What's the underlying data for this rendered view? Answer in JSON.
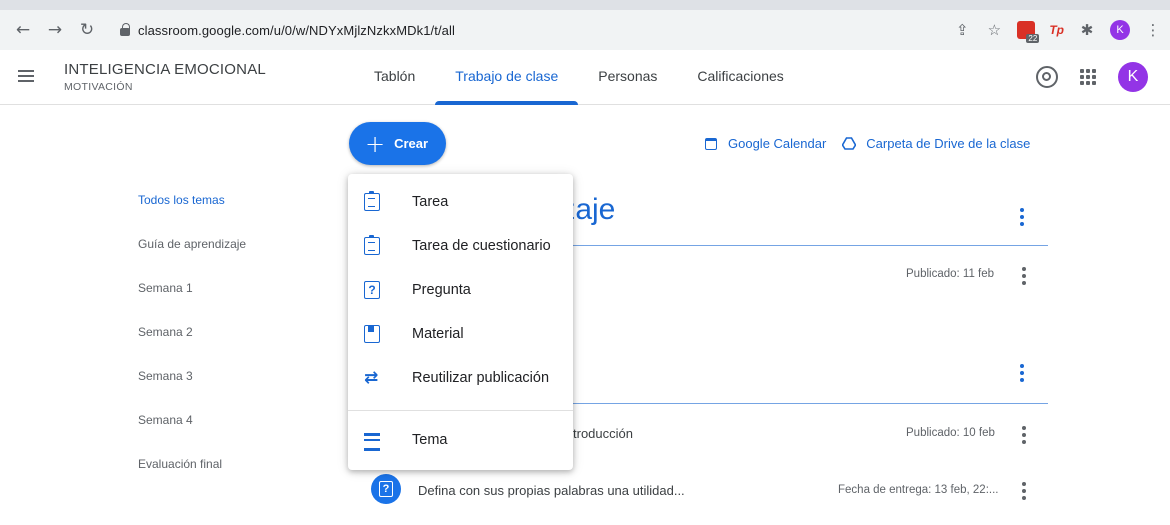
{
  "browser": {
    "url": "classroom.google.com/u/0/w/NDYxMjlzNzkxMDk1/t/all",
    "ext_badge": "22",
    "ext_tp": "Tp",
    "profile_initial": "K"
  },
  "header": {
    "class_name": "INTELIGENCIA EMOCIONAL",
    "section": "MOTIVACIÓN",
    "tabs": [
      {
        "label": "Tablón"
      },
      {
        "label": "Trabajo de clase"
      },
      {
        "label": "Personas"
      },
      {
        "label": "Calificaciones"
      }
    ],
    "avatar_initial": "K"
  },
  "toolbar": {
    "create_label": "Crear",
    "calendar_label": "Google Calendar",
    "drive_label": "Carpeta de Drive de la clase"
  },
  "topics": [
    {
      "label": "Todos los temas"
    },
    {
      "label": "Guía de aprendizaje"
    },
    {
      "label": "Semana 1"
    },
    {
      "label": "Semana 2"
    },
    {
      "label": "Semana 3"
    },
    {
      "label": "Semana 4"
    },
    {
      "label": "Evaluación final"
    }
  ],
  "main": {
    "section_title_fragment": "lizaje",
    "item1_meta": "Publicado: 11 feb",
    "item2_text_fragment": "troducción",
    "item2_meta": "Publicado: 10 feb",
    "item3_text": "Defina con sus propias palabras una utilidad...",
    "item3_meta": "Fecha de entrega: 13 feb, 22:..."
  },
  "menu": {
    "items": [
      {
        "label": "Tarea"
      },
      {
        "label": "Tarea de cuestionario"
      },
      {
        "label": "Pregunta"
      },
      {
        "label": "Material"
      },
      {
        "label": "Reutilizar publicación"
      },
      {
        "label": "Tema"
      }
    ]
  },
  "colors": {
    "accent": "#1967d2",
    "button": "#1a73e8",
    "avatar": "#9334e6"
  }
}
